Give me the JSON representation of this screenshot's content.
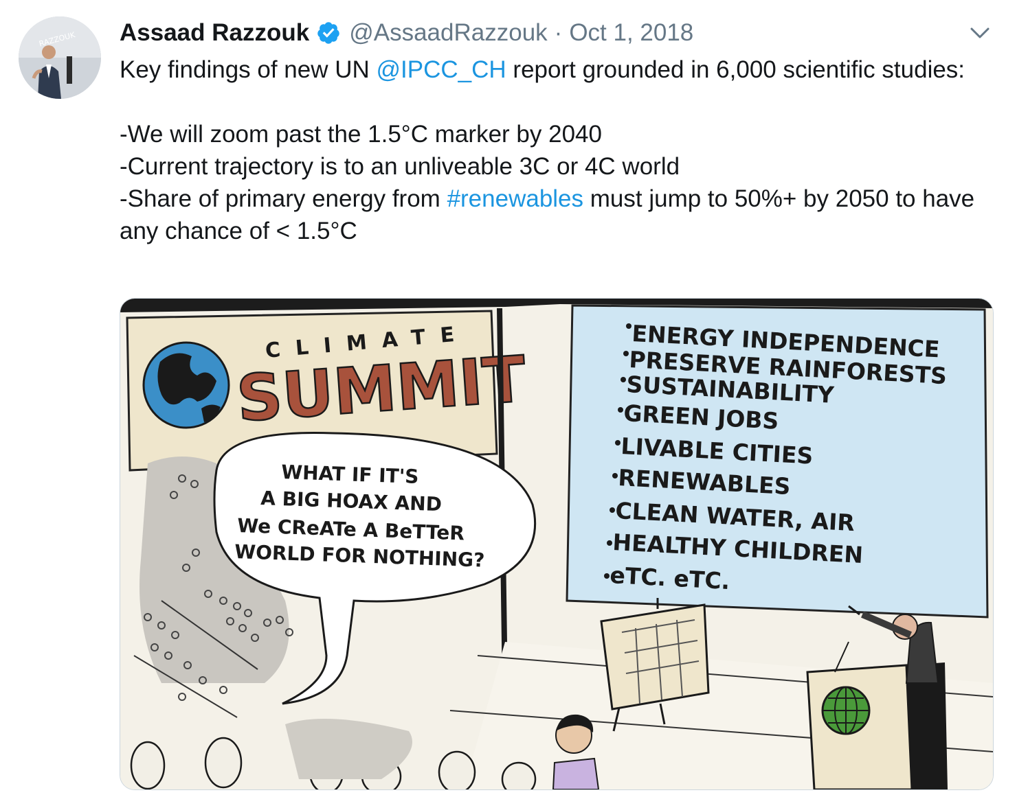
{
  "author": {
    "display_name": "Assaad Razzouk",
    "handle": "@AssaadRazzouk",
    "separator": "·",
    "date": "Oct 1, 2018",
    "verified": true,
    "avatar_watermark": "RAZZOUK"
  },
  "tweet": {
    "line1_before": "Key findings of new UN ",
    "line1_mention": "@IPCC_CH",
    "line1_after": " report grounded in 6,000 scientific studies:",
    "bullet1": "-We will zoom past the 1.5°C marker by 2040",
    "bullet2": "-Current trajectory is to an unliveable 3C or 4C world",
    "bullet3_before": "-Share of primary energy from ",
    "bullet3_hashtag": "#renewables",
    "bullet3_after": " must jump to 50%+ by 2050 to have any chance of < 1.5°C"
  },
  "cartoon": {
    "banner_top": "CLIMATE",
    "banner_main": "SUMMIT",
    "speech": [
      "WHAT IF IT'S",
      "A BIG HOAX AND",
      "We CReATe A BeTTeR",
      "WORLD FOR NOTHING?"
    ],
    "board_items": [
      "ENERGY INDEPENDENCE",
      "PRESERVE RAINFORESTS",
      "SUSTAINABILITY",
      "GREEN JOBS",
      "LIVABLE CITIES",
      "RENEWABLES",
      "CLEAN WATER, AIR",
      "HEALTHY CHILDREN",
      "eTC. eTC."
    ]
  },
  "colors": {
    "link": "#1b95e0",
    "verified": "#1da1f2",
    "meta_text": "#657786",
    "board_blue": "#cfe6f3",
    "banner_bg": "#efe6cc",
    "summit_red": "#a8523c"
  },
  "icons": {
    "verified": "verified-badge-icon",
    "caret": "chevron-down-icon"
  }
}
